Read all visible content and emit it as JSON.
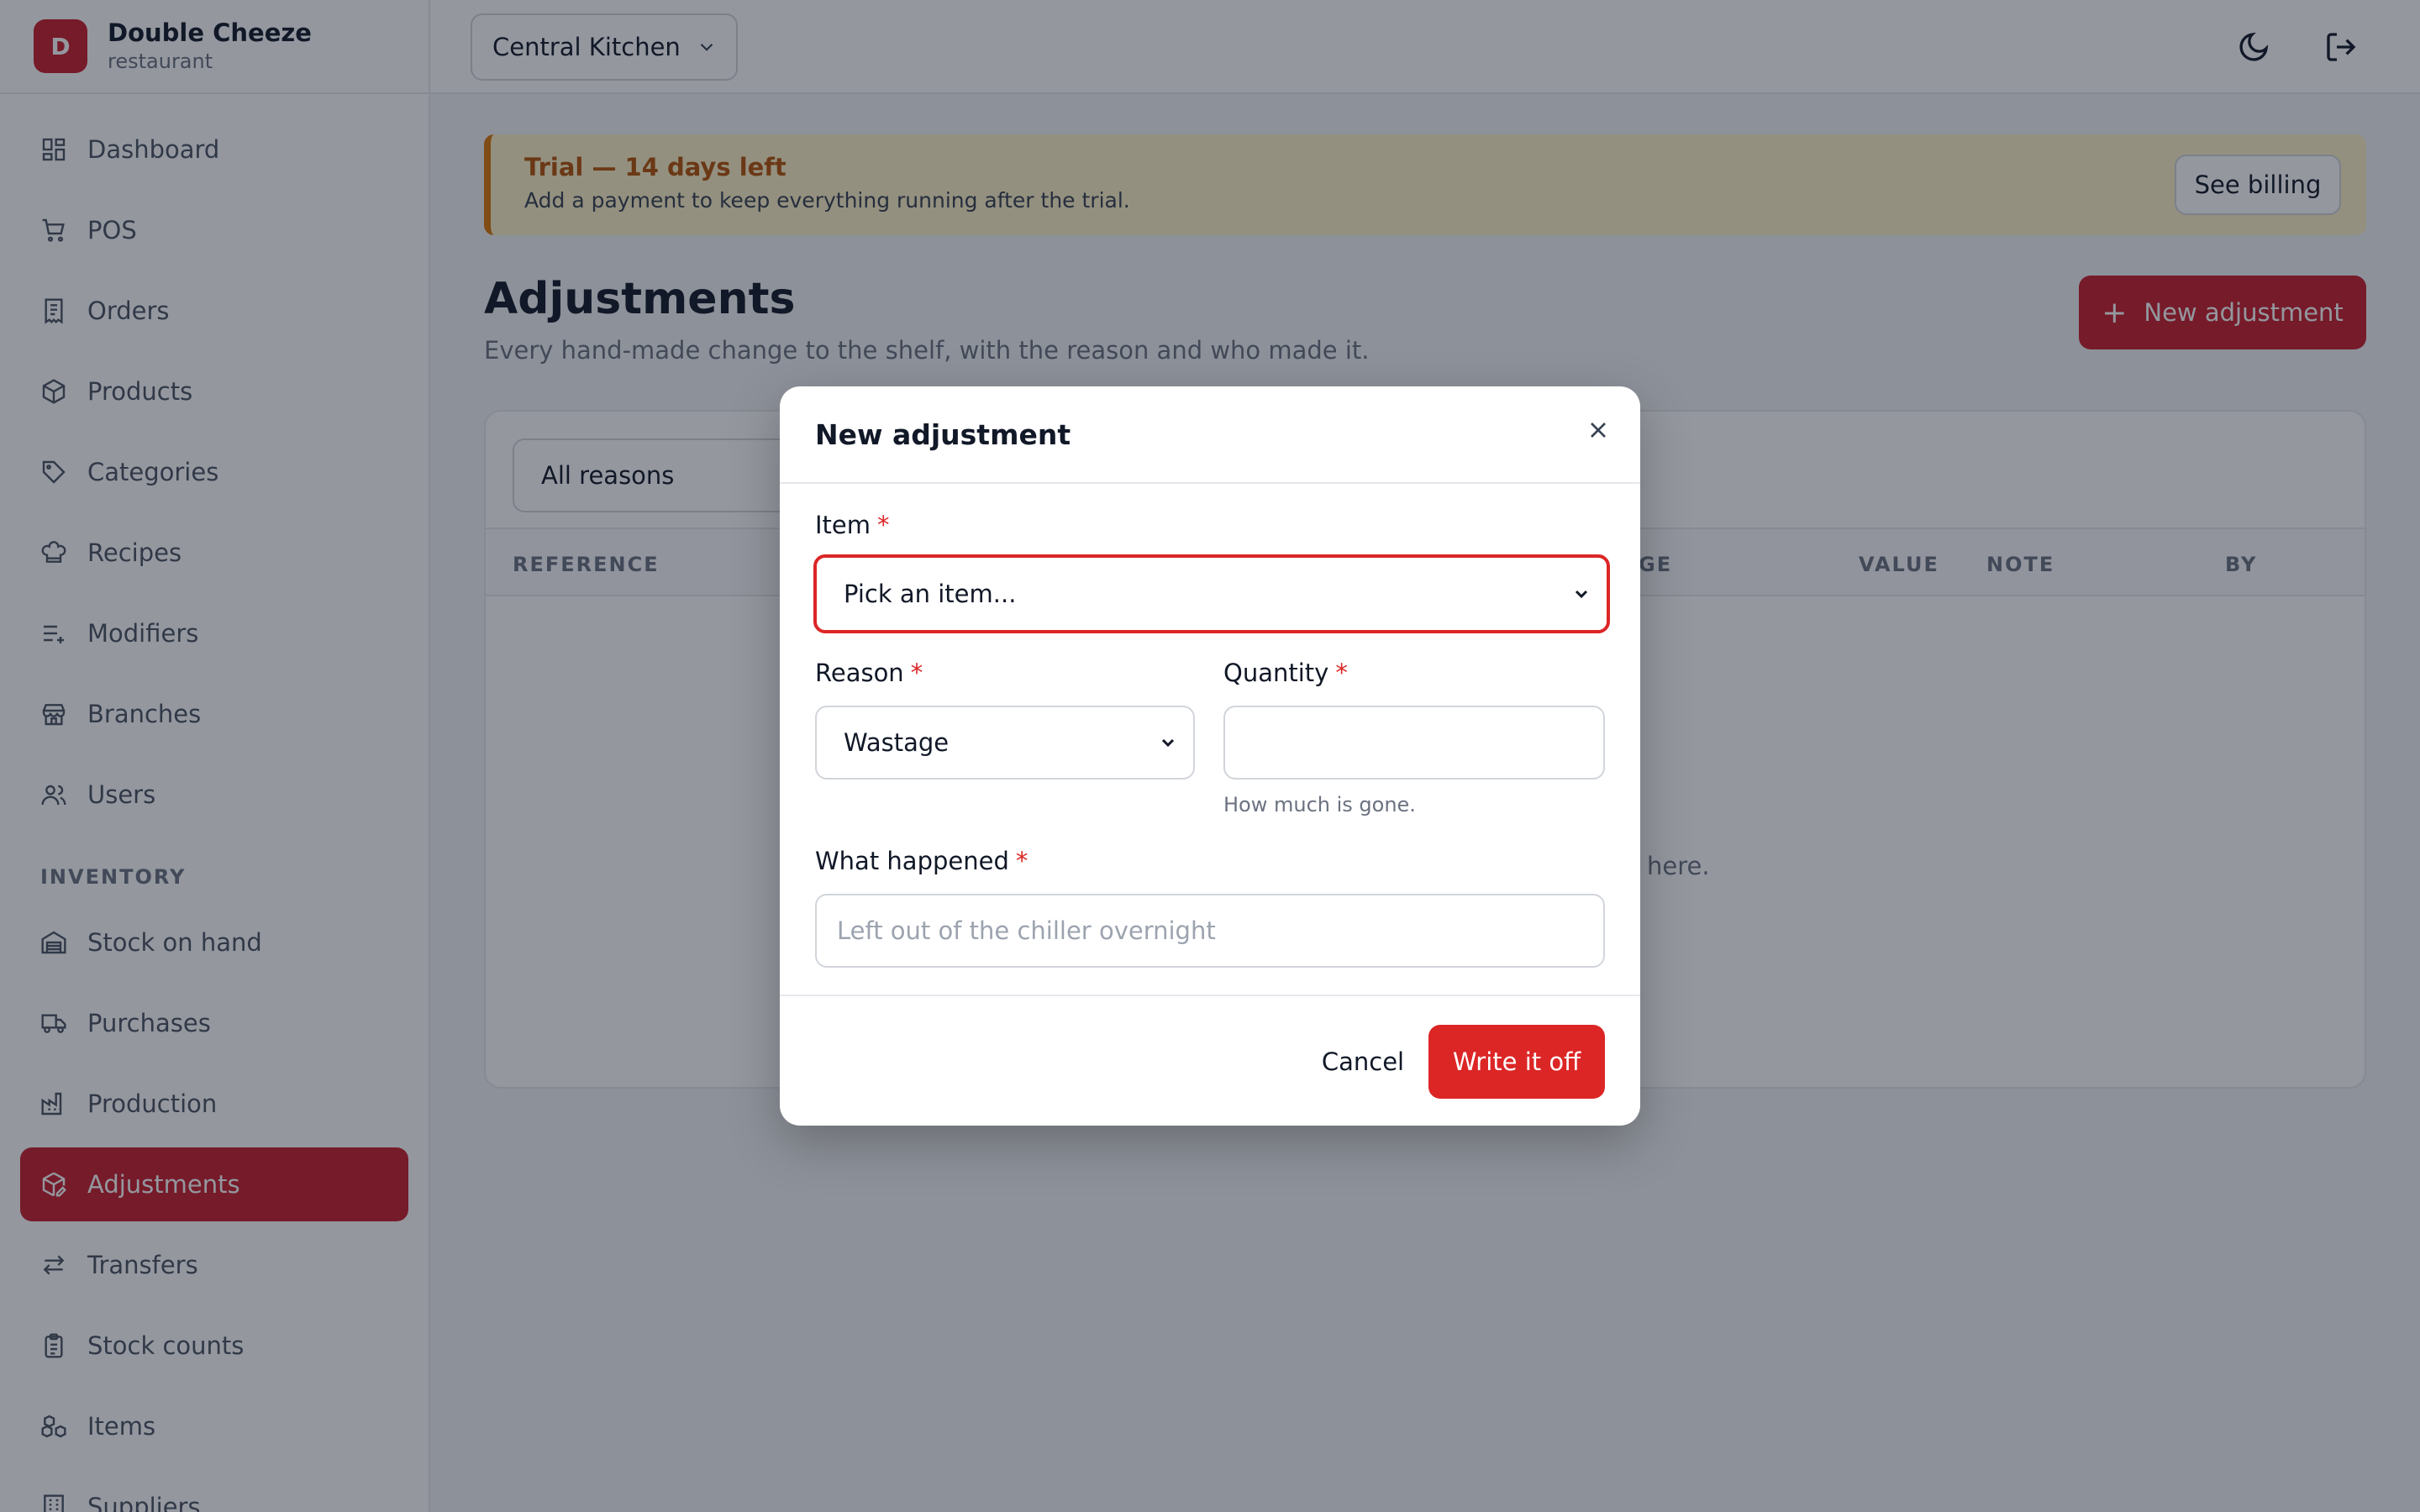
{
  "brand": {
    "initial": "D",
    "name": "Double Cheeze",
    "subtitle": "restaurant"
  },
  "sidebar": {
    "items": [
      {
        "label": "Dashboard",
        "icon": "dashboard-icon"
      },
      {
        "label": "POS",
        "icon": "cart-icon"
      },
      {
        "label": "Orders",
        "icon": "receipt-icon"
      },
      {
        "label": "Products",
        "icon": "package-icon"
      },
      {
        "label": "Categories",
        "icon": "tag-icon"
      },
      {
        "label": "Recipes",
        "icon": "chef-hat-icon"
      },
      {
        "label": "Modifiers",
        "icon": "list-plus-icon"
      },
      {
        "label": "Branches",
        "icon": "store-icon"
      },
      {
        "label": "Users",
        "icon": "users-icon"
      }
    ],
    "section_label": "INVENTORY",
    "inventory_items": [
      {
        "label": "Stock on hand",
        "icon": "warehouse-icon"
      },
      {
        "label": "Purchases",
        "icon": "truck-icon"
      },
      {
        "label": "Production",
        "icon": "factory-icon"
      },
      {
        "label": "Adjustments",
        "icon": "package-edit-icon",
        "active": true
      },
      {
        "label": "Transfers",
        "icon": "arrows-swap-icon"
      },
      {
        "label": "Stock counts",
        "icon": "clipboard-icon"
      },
      {
        "label": "Items",
        "icon": "boxes-icon"
      },
      {
        "label": "Suppliers",
        "icon": "building-icon"
      }
    ]
  },
  "topbar": {
    "branch": "Central Kitchen"
  },
  "trial": {
    "title": "Trial — 14 days left",
    "subtitle": "Add a payment to keep everything running after the trial.",
    "billing_label": "See billing"
  },
  "page": {
    "title": "Adjustments",
    "subtitle": "Every hand-made change to the shelf, with the reason and who made it.",
    "new_button": "New adjustment"
  },
  "table": {
    "filter": "All reasons",
    "columns": {
      "reference": "REFERENCE",
      "change": "GE",
      "value": "VALUE",
      "note": "NOTE",
      "by": "BY"
    },
    "empty_fragment": "here."
  },
  "modal": {
    "title": "New adjustment",
    "item_label": "Item",
    "item_placeholder": "Pick an item...",
    "reason_label": "Reason",
    "reason_value": "Wastage",
    "quantity_label": "Quantity",
    "quantity_value": "",
    "quantity_hint": "How much is gone.",
    "what_label": "What happened",
    "what_placeholder": "Left out of the chiller overnight",
    "required_mark": "*",
    "cancel_label": "Cancel",
    "submit_label": "Write it off"
  },
  "colors": {
    "brand": "#c81e2d",
    "danger": "#dc2626",
    "trial_accent": "#d97706"
  }
}
